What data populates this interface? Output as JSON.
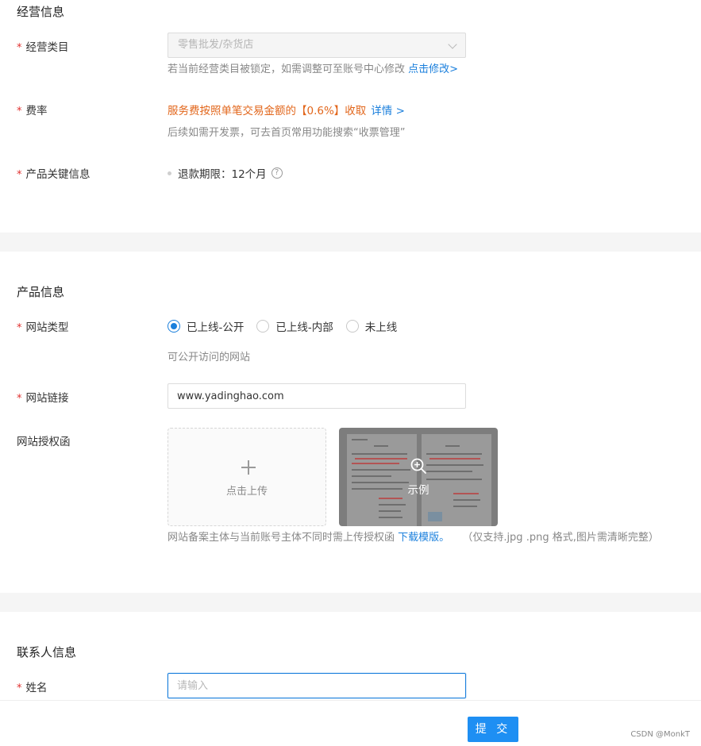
{
  "business": {
    "title": "经营信息",
    "category_label": "经营类目",
    "category_value": "零售批发/杂货店",
    "category_hint": "若当前经营类目被锁定，如需调整可至账号中心修改",
    "category_hint_link": "点击修改>",
    "rate_label": "费率",
    "rate_text": "服务费按照单笔交易金额的【0.6%】收取",
    "rate_detail": "详情 >",
    "rate_hint": "后续如需开发票，可去首页常用功能搜索“收票管理”",
    "key_label": "产品关键信息",
    "key_value": "退款期限：12个月",
    "help_glyph": "?"
  },
  "product": {
    "title": "产品信息",
    "site_type_label": "网站类型",
    "site_type_options": [
      "已上线-公开",
      "已上线-内部",
      "未上线"
    ],
    "site_type_selected": "已上线-公开",
    "site_type_hint": "可公开访问的网站",
    "site_link_label": "网站链接",
    "site_link_value": "www.yadinghao.com",
    "auth_label": "网站授权函",
    "upload_text": "点击上传",
    "sample_text": "示例",
    "auth_hint": "网站备案主体与当前账号主体不同时需上传授权函",
    "auth_hint_link": "下载模版。",
    "auth_hint_note": "（仅支持.jpg .png 格式,图片需清晰完整）"
  },
  "contact": {
    "title": "联系人信息",
    "name_label": "姓名",
    "name_placeholder": "请输入"
  },
  "footer": {
    "submit_label": "提 交",
    "watermark": "CSDN @MonkT"
  },
  "colors": {
    "accent": "#1a7fdc",
    "required": "#e0302f",
    "rate": "#e2661b",
    "button": "#1e8ff3"
  }
}
